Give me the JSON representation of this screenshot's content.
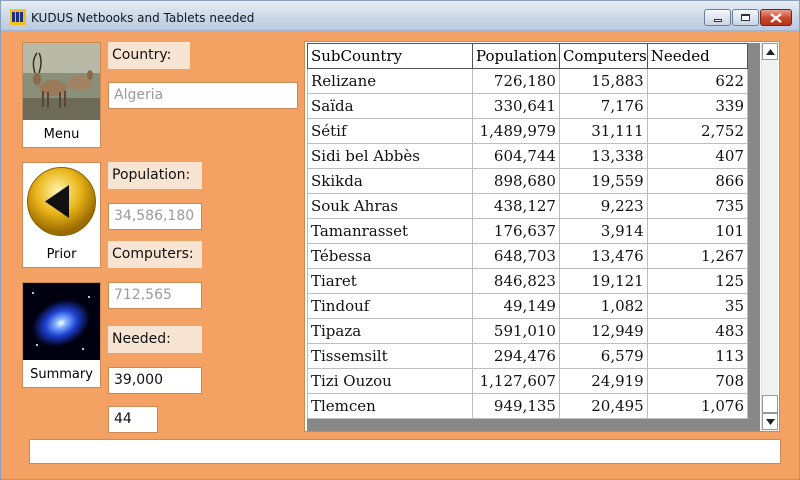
{
  "window": {
    "title": "KUDUS Netbooks and Tablets needed"
  },
  "nav": {
    "menu": {
      "label": "Menu",
      "icon": "kudu-photo-icon"
    },
    "prior": {
      "label": "Prior",
      "icon": "back-arrow-icon"
    },
    "summary": {
      "label": "Summary",
      "icon": "galaxy-icon"
    }
  },
  "form": {
    "country_label": "Country:",
    "country_value": "Algeria",
    "population_label": "Population:",
    "population_value": "34,586,180",
    "computers_label": "Computers:",
    "computers_value": "712,565",
    "needed_label": "Needed:",
    "needed_value": "39,000",
    "extra_value": "44"
  },
  "grid": {
    "columns": [
      "SubCountry",
      "Population",
      "Computers",
      "Needed"
    ],
    "rows": [
      [
        "Relizane",
        "726,180",
        "15,883",
        "622"
      ],
      [
        "Saïda",
        "330,641",
        "7,176",
        "339"
      ],
      [
        "Sétif",
        "1,489,979",
        "31,111",
        "2,752"
      ],
      [
        "Sidi bel Abbès",
        "604,744",
        "13,338",
        "407"
      ],
      [
        "Skikda",
        "898,680",
        "19,559",
        "866"
      ],
      [
        "Souk Ahras",
        "438,127",
        "9,223",
        "735"
      ],
      [
        "Tamanrasset",
        "176,637",
        "3,914",
        "101"
      ],
      [
        "Tébessa",
        "648,703",
        "13,476",
        "1,267"
      ],
      [
        "Tiaret",
        "846,823",
        "19,121",
        "125"
      ],
      [
        "Tindouf",
        "49,149",
        "1,082",
        "35"
      ],
      [
        "Tipaza",
        "591,010",
        "12,949",
        "483"
      ],
      [
        "Tissemsilt",
        "294,476",
        "6,579",
        "113"
      ],
      [
        "Tizi Ouzou",
        "1,127,607",
        "24,919",
        "708"
      ],
      [
        "Tlemcen",
        "949,135",
        "20,495",
        "1,076"
      ]
    ]
  },
  "status": {
    "text": ""
  },
  "colors": {
    "background": "#f3a263",
    "label_bg": "#f8e4d2"
  }
}
